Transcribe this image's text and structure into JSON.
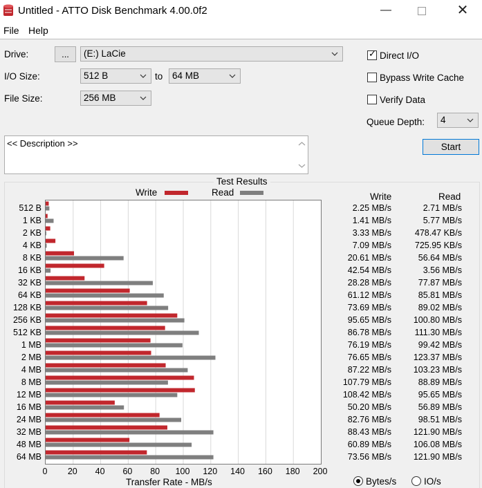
{
  "window": {
    "title": "Untitled - ATTO Disk Benchmark 4.00.0f2",
    "minimize_icon": "minimize-icon",
    "maximize_icon": "maximize-icon",
    "close_icon": "close-icon"
  },
  "menu": {
    "file": "File",
    "help": "Help"
  },
  "form": {
    "drive_label": "Drive:",
    "browse_label": "...",
    "drive_value": "(E:) LaCie",
    "io_size_label": "I/O Size:",
    "io_from": "512 B",
    "to_label": "to",
    "io_to": "64 MB",
    "file_size_label": "File Size:",
    "file_size_value": "256 MB",
    "direct_io_label": "Direct I/O",
    "direct_io_checked": true,
    "bypass_label": "Bypass Write Cache",
    "bypass_checked": false,
    "verify_label": "Verify Data",
    "verify_checked": false,
    "queue_label": "Queue Depth:",
    "queue_value": "4",
    "start_label": "Start",
    "description": "<< Description >>"
  },
  "results": {
    "title": "Test Results",
    "write_header": "Write",
    "read_header": "Read",
    "bytes_label": "Bytes/s",
    "ios_label": "IO/s",
    "bytes_selected": true,
    "rows": [
      {
        "size": "512 B",
        "write": "2.25 MB/s",
        "read": "2.71 MB/s"
      },
      {
        "size": "1 KB",
        "write": "1.41 MB/s",
        "read": "5.77 MB/s"
      },
      {
        "size": "2 KB",
        "write": "3.33 MB/s",
        "read": "478.47 KB/s"
      },
      {
        "size": "4 KB",
        "write": "7.09 MB/s",
        "read": "725.95 KB/s"
      },
      {
        "size": "8 KB",
        "write": "20.61 MB/s",
        "read": "56.64 MB/s"
      },
      {
        "size": "16 KB",
        "write": "42.54 MB/s",
        "read": "3.56 MB/s"
      },
      {
        "size": "32 KB",
        "write": "28.28 MB/s",
        "read": "77.87 MB/s"
      },
      {
        "size": "64 KB",
        "write": "61.12 MB/s",
        "read": "85.81 MB/s"
      },
      {
        "size": "128 KB",
        "write": "73.69 MB/s",
        "read": "89.02 MB/s"
      },
      {
        "size": "256 KB",
        "write": "95.65 MB/s",
        "read": "100.80 MB/s"
      },
      {
        "size": "512 KB",
        "write": "86.78 MB/s",
        "read": "111.30 MB/s"
      },
      {
        "size": "1 MB",
        "write": "76.19 MB/s",
        "read": "99.42 MB/s"
      },
      {
        "size": "2 MB",
        "write": "76.65 MB/s",
        "read": "123.37 MB/s"
      },
      {
        "size": "4 MB",
        "write": "87.22 MB/s",
        "read": "103.23 MB/s"
      },
      {
        "size": "8 MB",
        "write": "107.79 MB/s",
        "read": "88.89 MB/s"
      },
      {
        "size": "12 MB",
        "write": "108.42 MB/s",
        "read": "95.65 MB/s"
      },
      {
        "size": "16 MB",
        "write": "50.20 MB/s",
        "read": "56.89 MB/s"
      },
      {
        "size": "24 MB",
        "write": "82.76 MB/s",
        "read": "98.51 MB/s"
      },
      {
        "size": "32 MB",
        "write": "88.43 MB/s",
        "read": "121.90 MB/s"
      },
      {
        "size": "48 MB",
        "write": "60.89 MB/s",
        "read": "106.08 MB/s"
      },
      {
        "size": "64 MB",
        "write": "73.56 MB/s",
        "read": "121.90 MB/s"
      }
    ]
  },
  "chart_data": {
    "type": "bar",
    "orientation": "horizontal",
    "categories": [
      "512 B",
      "1 KB",
      "2 KB",
      "4 KB",
      "8 KB",
      "16 KB",
      "32 KB",
      "64 KB",
      "128 KB",
      "256 KB",
      "512 KB",
      "1 MB",
      "2 MB",
      "4 MB",
      "8 MB",
      "12 MB",
      "16 MB",
      "24 MB",
      "32 MB",
      "48 MB",
      "64 MB"
    ],
    "series": [
      {
        "name": "Write",
        "color": "#c1272d",
        "values": [
          2.25,
          1.41,
          3.33,
          7.09,
          20.61,
          42.54,
          28.28,
          61.12,
          73.69,
          95.65,
          86.78,
          76.19,
          76.65,
          87.22,
          107.79,
          108.42,
          50.2,
          82.76,
          88.43,
          60.89,
          73.56
        ]
      },
      {
        "name": "Read",
        "color": "#7f7f7f",
        "values": [
          2.71,
          5.77,
          0.48,
          0.73,
          56.64,
          3.56,
          77.87,
          85.81,
          89.02,
          100.8,
          111.3,
          99.42,
          123.37,
          103.23,
          88.89,
          95.65,
          56.89,
          98.51,
          121.9,
          106.08,
          121.9
        ]
      }
    ],
    "xlabel": "Transfer Rate - MB/s",
    "xlim": [
      0,
      200
    ],
    "xticks": [
      0,
      20,
      40,
      60,
      80,
      100,
      120,
      140,
      160,
      180,
      200
    ],
    "grid": true,
    "legend": "top"
  }
}
